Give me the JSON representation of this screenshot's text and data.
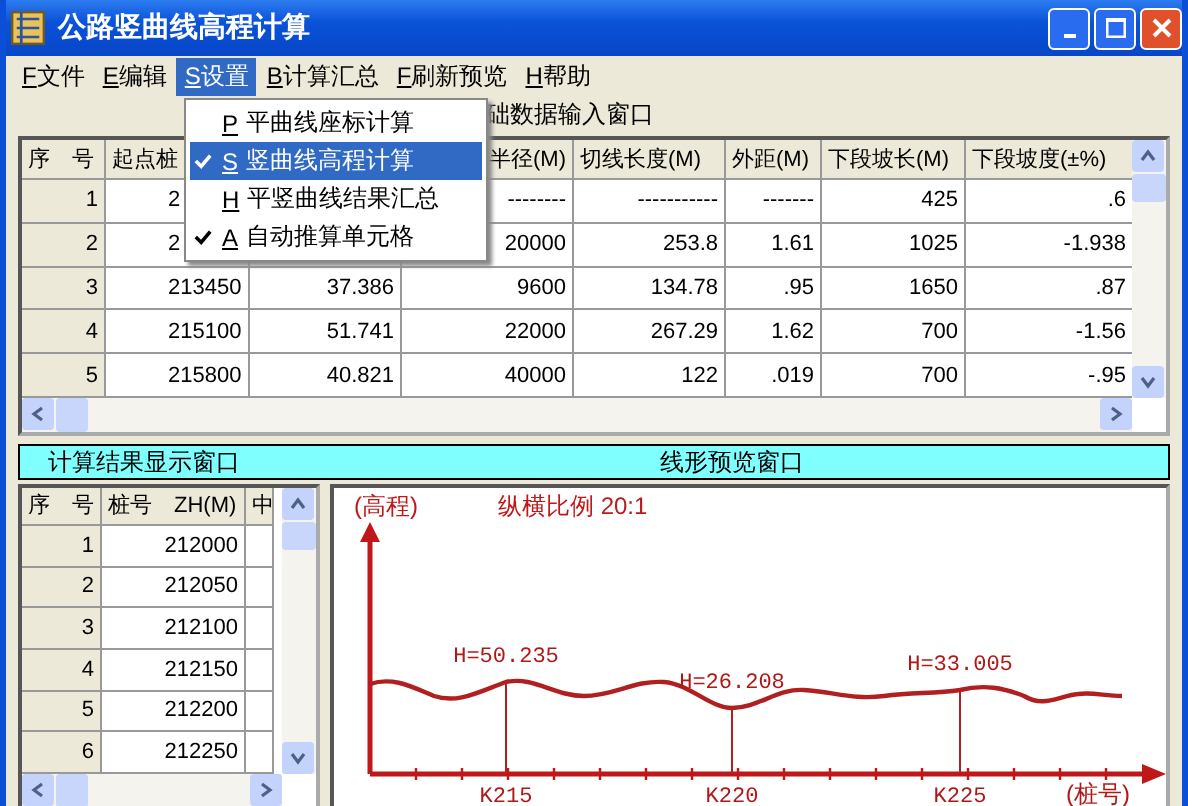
{
  "window": {
    "title": "公路竖曲线高程计算"
  },
  "menu_bar": [
    {
      "key": "F",
      "label": "文件",
      "selected": false
    },
    {
      "key": "E",
      "label": "编辑",
      "selected": false
    },
    {
      "key": "S",
      "label": "设置",
      "selected": true
    },
    {
      "key": "B",
      "label": "计算汇总",
      "selected": false
    },
    {
      "key": "F",
      "label": "刷新预览",
      "selected": false
    },
    {
      "key": "H",
      "label": "帮助",
      "selected": false
    }
  ],
  "open_menu": [
    {
      "key": "P",
      "label": "平曲线座标计算",
      "checked": false,
      "selected": false
    },
    {
      "key": "S",
      "label": "竖曲线高程计算",
      "checked": true,
      "selected": true
    },
    {
      "key": "H",
      "label": "平竖曲线结果汇总",
      "checked": false,
      "selected": false
    },
    {
      "key": "A",
      "label": "自动推算单元格",
      "checked": true,
      "selected": false
    }
  ],
  "input_panel": {
    "title": "础数据输入窗口",
    "columns": [
      "序　号",
      "起点桩",
      null,
      "半径(M)",
      "切线长度(M)",
      "外距(M)",
      "下段坡长(M)",
      "下段坡度(±%)"
    ],
    "rows": [
      [
        "1",
        "2",
        null,
        "--------",
        "-----------",
        "-------",
        "425",
        ".6"
      ],
      [
        "2",
        "2",
        null,
        "20000",
        "253.8",
        "1.61",
        "1025",
        "-1.938"
      ],
      [
        "3",
        "213450",
        "37.386",
        "9600",
        "134.78",
        ".95",
        "1650",
        ".87"
      ],
      [
        "4",
        "215100",
        "51.741",
        "22000",
        "267.29",
        "1.62",
        "700",
        "-1.56"
      ],
      [
        "5",
        "215800",
        "40.821",
        "40000",
        "122",
        ".019",
        "700",
        "-.95"
      ]
    ]
  },
  "result_panel": {
    "title": "计算结果显示窗口",
    "columns": [
      "序　号",
      "桩号　ZH(M)",
      "中"
    ],
    "rows": [
      [
        "1",
        "212000"
      ],
      [
        "2",
        "212050"
      ],
      [
        "3",
        "212100"
      ],
      [
        "4",
        "212150"
      ],
      [
        "5",
        "212200"
      ],
      [
        "6",
        "212250"
      ]
    ]
  },
  "preview_panel": {
    "title": "线形预览窗口",
    "y_label": "(高程)",
    "scale": "纵横比例 20:1",
    "x_label": "(桩号)",
    "markers": [
      {
        "height": "H=50.235",
        "station": "K215"
      },
      {
        "height": "H=26.208",
        "station": "K220"
      },
      {
        "height": "H=33.005",
        "station": "K225"
      }
    ]
  }
}
